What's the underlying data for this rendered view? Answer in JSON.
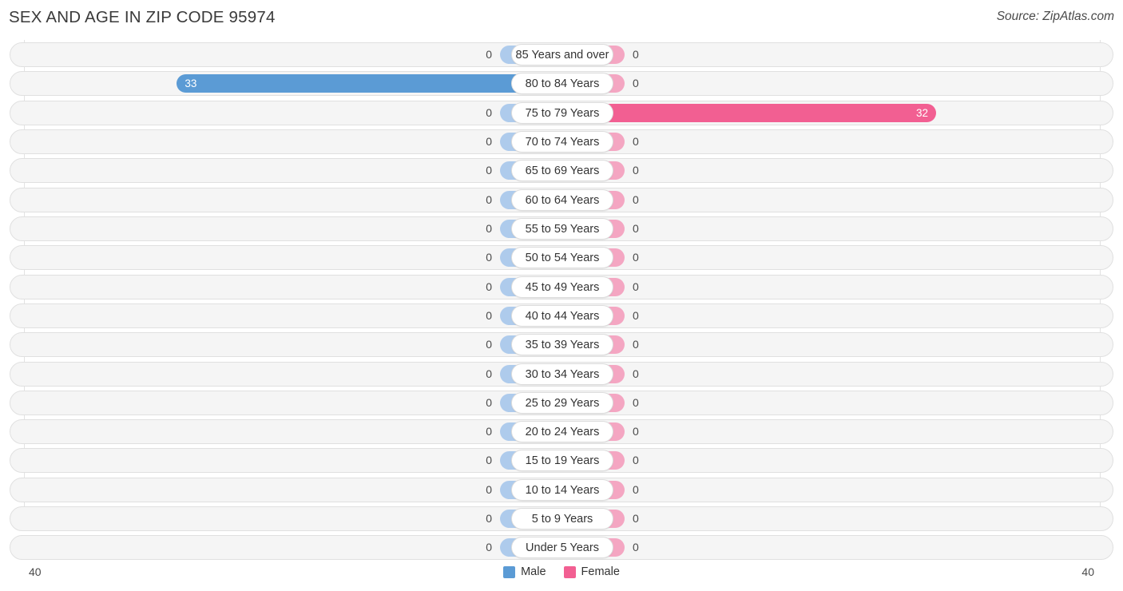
{
  "header": {
    "title": "SEX AND AGE IN ZIP CODE 95974",
    "source": "Source: ZipAtlas.com"
  },
  "legend": {
    "male_label": "Male",
    "female_label": "Female",
    "male_color": "#5b9bd5",
    "female_color": "#f25f92"
  },
  "colors": {
    "male_strong": "#5b9bd5",
    "male_light": "#aecbec",
    "female_strong": "#f25f92",
    "female_light": "#f4a6c2",
    "row_background": "#f5f5f5",
    "row_border": "#e0e0e0",
    "label_background": "#ffffff"
  },
  "axis": {
    "left_label": "40",
    "right_label": "40",
    "max": 40
  },
  "chart_data": {
    "type": "bar",
    "title": "SEX AND AGE IN ZIP CODE 95974",
    "subtitle": "Source: ZipAtlas.com",
    "xlabel": "",
    "ylabel": "",
    "orientation": "horizontal",
    "layout": "population-pyramid",
    "grid": false,
    "legend_position": "bottom-center",
    "xlim": [
      40,
      40
    ],
    "categories": [
      "85 Years and over",
      "80 to 84 Years",
      "75 to 79 Years",
      "70 to 74 Years",
      "65 to 69 Years",
      "60 to 64 Years",
      "55 to 59 Years",
      "50 to 54 Years",
      "45 to 49 Years",
      "40 to 44 Years",
      "35 to 39 Years",
      "30 to 34 Years",
      "25 to 29 Years",
      "20 to 24 Years",
      "15 to 19 Years",
      "10 to 14 Years",
      "5 to 9 Years",
      "Under 5 Years"
    ],
    "series": [
      {
        "name": "Male",
        "color": "#5b9bd5",
        "values": [
          0,
          33,
          0,
          0,
          0,
          0,
          0,
          0,
          0,
          0,
          0,
          0,
          0,
          0,
          0,
          0,
          0,
          0
        ]
      },
      {
        "name": "Female",
        "color": "#f25f92",
        "values": [
          0,
          0,
          32,
          0,
          0,
          0,
          0,
          0,
          0,
          0,
          0,
          0,
          0,
          0,
          0,
          0,
          0,
          0
        ]
      }
    ]
  },
  "rows": [
    {
      "age": "85 Years and over",
      "male": "0",
      "female": "0"
    },
    {
      "age": "80 to 84 Years",
      "male": "33",
      "female": "0"
    },
    {
      "age": "75 to 79 Years",
      "male": "0",
      "female": "32"
    },
    {
      "age": "70 to 74 Years",
      "male": "0",
      "female": "0"
    },
    {
      "age": "65 to 69 Years",
      "male": "0",
      "female": "0"
    },
    {
      "age": "60 to 64 Years",
      "male": "0",
      "female": "0"
    },
    {
      "age": "55 to 59 Years",
      "male": "0",
      "female": "0"
    },
    {
      "age": "50 to 54 Years",
      "male": "0",
      "female": "0"
    },
    {
      "age": "45 to 49 Years",
      "male": "0",
      "female": "0"
    },
    {
      "age": "40 to 44 Years",
      "male": "0",
      "female": "0"
    },
    {
      "age": "35 to 39 Years",
      "male": "0",
      "female": "0"
    },
    {
      "age": "30 to 34 Years",
      "male": "0",
      "female": "0"
    },
    {
      "age": "25 to 29 Years",
      "male": "0",
      "female": "0"
    },
    {
      "age": "20 to 24 Years",
      "male": "0",
      "female": "0"
    },
    {
      "age": "15 to 19 Years",
      "male": "0",
      "female": "0"
    },
    {
      "age": "10 to 14 Years",
      "male": "0",
      "female": "0"
    },
    {
      "age": "5 to 9 Years",
      "male": "0",
      "female": "0"
    },
    {
      "age": "Under 5 Years",
      "male": "0",
      "female": "0"
    }
  ]
}
